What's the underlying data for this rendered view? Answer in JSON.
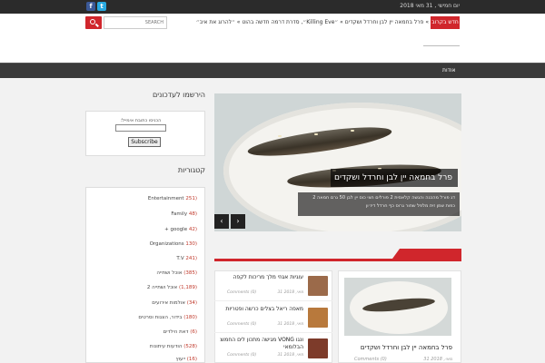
{
  "topbar": {
    "date": "יום חמישי , 31 מאי 2018",
    "social": [
      {
        "icon": "facebook-icon",
        "glyph": "f",
        "color": "#3b5998"
      },
      {
        "icon": "twitter-icon",
        "glyph": "t",
        "color": "#28a9e1"
      }
    ]
  },
  "ticker": {
    "label": "חדש בקרוב",
    "text": "» פרל בחמאה יין לבן וחרדל ושקדים  » ״Killing Eve״, סדרת דרמה חדשה בהוט  » ״להרוג את איב״",
    "search_placeholder": "SEARCH"
  },
  "nav": {
    "items": [
      "אודות"
    ]
  },
  "sidebar": {
    "subscribe_title": "הירשמו לעדכונים",
    "subscribe_label": "הכניסו כתובת אימייל:",
    "subscribe_button": "Subscribe",
    "categories_title": "קטגוריות",
    "categories": [
      {
        "name": "Entertainment",
        "count": "(251"
      },
      {
        "name": "Family",
        "count": "(48"
      },
      {
        "name": "google +",
        "count": "(42"
      },
      {
        "name": "Organizations",
        "count": "(130"
      },
      {
        "name": "T.V",
        "count": "(241"
      },
      {
        "name": "אוכל ושתייה",
        "count": "(385)"
      },
      {
        "name": "אוכל ושתייה 2",
        "count": "(1,189)"
      },
      {
        "name": "אולמות אירועים",
        "count": "(34)"
      },
      {
        "name": "בידור, הצגות וסרטים",
        "count": "(180)"
      },
      {
        "name": "דאת הילדים",
        "count": "(6)"
      },
      {
        "name": "הודעות עיתונות",
        "count": "(528)"
      },
      {
        "name": "ייעוץ",
        "count": "(16)"
      }
    ]
  },
  "slider": {
    "caption": "פרל בחמאה יין לבן וחרדל ושקדים",
    "excerpt": "דג פורל מהכנה והגשה קלאסית 2 פורלים חצי כוס יין לבן 50 גרם חמאה 2 כפות שמן זית מלפל שחור גרוס כף חרדל דיז׳ון",
    "prev": "‹",
    "next": "›"
  },
  "main_post": {
    "title": "פרל בחמאה יין לבן וחרדל ושקדים",
    "date": "31 מאי, 2018",
    "comments": "Comments (0)"
  },
  "side_posts": [
    {
      "title": "עוגיות אגוזי מלך מריכות לקפה",
      "date": "31 מאי, 2018",
      "comments": "Comments (0)",
      "thumb": "#9b6a4a"
    },
    {
      "title": "מאפה ריאל בצלים כרשה ופטריות",
      "date": "31 מאי, 2018",
      "comments": "Comments (0)",
      "thumb": "#b8793c"
    },
    {
      "title": "ונגו VONG מגישה מתכון לים החמוצ הבלומאי",
      "date": "31 מאי, 2018",
      "comments": "Comments (0)",
      "thumb": "#7d3b2a"
    }
  ]
}
